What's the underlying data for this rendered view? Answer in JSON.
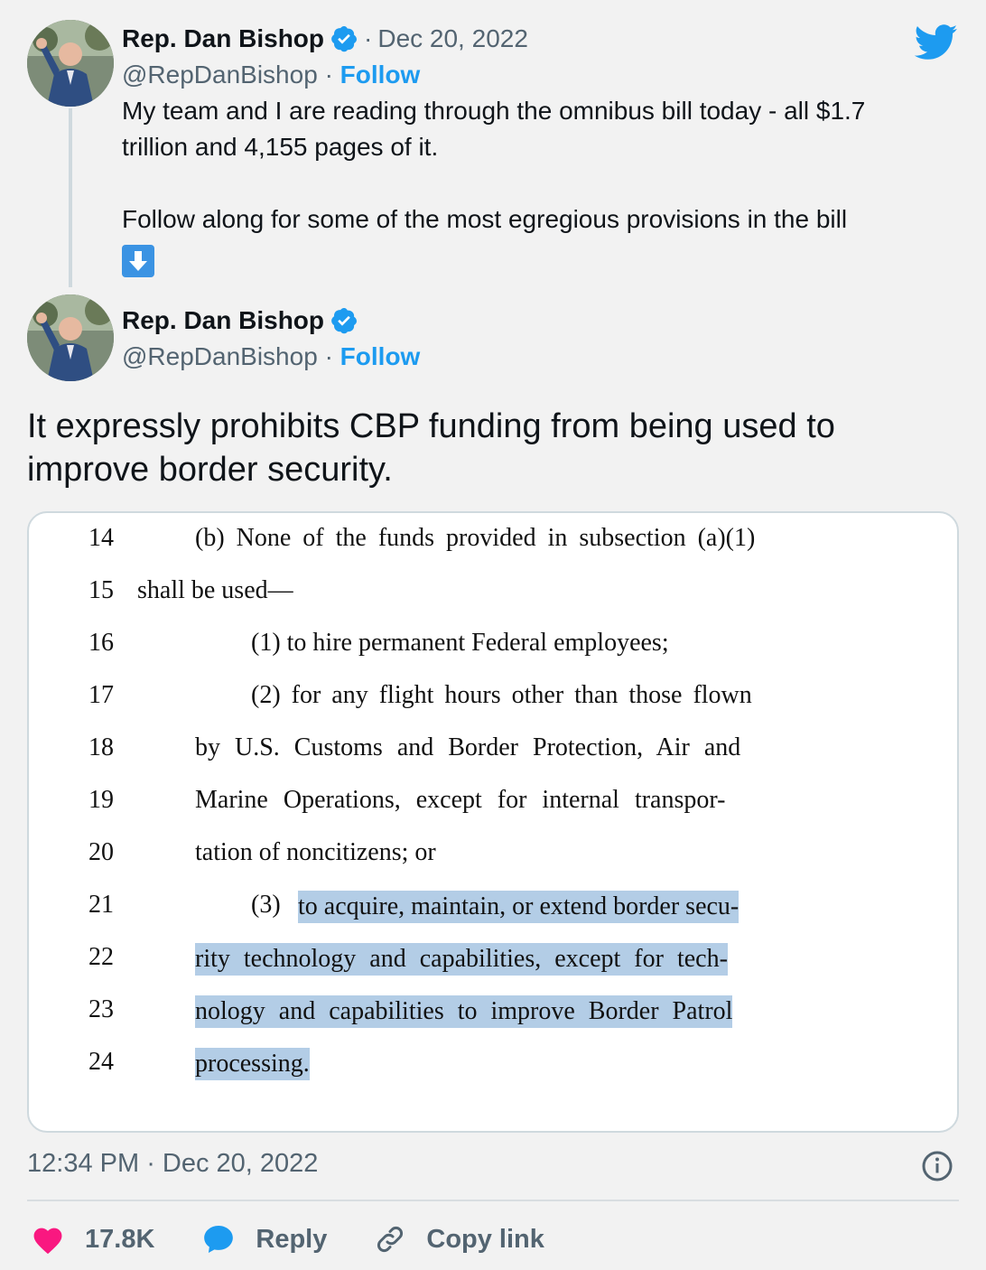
{
  "tweet1": {
    "name": "Rep. Dan Bishop",
    "date": "Dec 20, 2022",
    "handle": "@RepDanBishop",
    "follow": "Follow",
    "text_line1": "My team and I are reading through the omnibus bill today - all $1.7",
    "text_line2": "trillion and 4,155 pages of it.",
    "text_line3": "Follow along for some of the most egregious provisions in the bill"
  },
  "tweet2": {
    "name": "Rep. Dan Bishop",
    "handle": "@RepDanBishop",
    "follow": "Follow",
    "text_line1": "It expressly prohibits CBP funding from being used to",
    "text_line2": "improve border security."
  },
  "document": {
    "lines": [
      {
        "num": "14",
        "text": "(b) None of the funds provided in subsection (a)(1)"
      },
      {
        "num": "15",
        "text": "shall be used—"
      },
      {
        "num": "16",
        "text": "(1) to hire permanent Federal employees;"
      },
      {
        "num": "17",
        "text": "(2) for any flight hours other than those flown"
      },
      {
        "num": "18",
        "text": "by U.S. Customs and Border Protection, Air and"
      },
      {
        "num": "19",
        "text": "Marine Operations, except for internal transpor-"
      },
      {
        "num": "20",
        "text": "tation of noncitizens; or"
      },
      {
        "num": "21",
        "prefix": "(3)",
        "text": "to acquire, maintain, or extend border secu-"
      },
      {
        "num": "22",
        "text": "rity technology and capabilities, except for tech-"
      },
      {
        "num": "23",
        "text": "nology and capabilities to improve Border Patrol"
      },
      {
        "num": "24",
        "text": "processing."
      }
    ]
  },
  "footer": {
    "time": "12:34 PM",
    "date": "Dec 20, 2022",
    "likes": "17.8K",
    "reply": "Reply",
    "copy_link": "Copy link"
  },
  "colors": {
    "accent": "#1d9bf0",
    "like": "#f91880",
    "highlight": "#b3cde6"
  },
  "icons": [
    "twitter-bird-icon",
    "verified-badge-icon",
    "down-arrow-emoji-icon",
    "info-icon",
    "heart-icon",
    "reply-bubble-icon",
    "link-icon"
  ]
}
